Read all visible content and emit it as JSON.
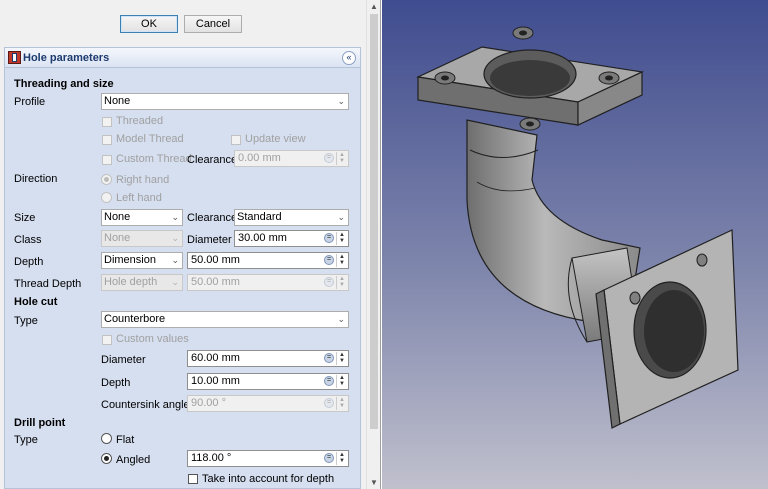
{
  "buttons": {
    "ok": "OK",
    "cancel": "Cancel"
  },
  "box": {
    "title": "Hole parameters",
    "collapse_glyph": "«"
  },
  "threading": {
    "section": "Threading and size",
    "profile_label": "Profile",
    "profile_value": "None",
    "threaded": "Threaded",
    "model_thread": "Model Thread",
    "update_view": "Update view",
    "custom_thread": "Custom Thread",
    "clearance_label": "Clearance",
    "clearance_value": "0.00 mm",
    "direction_label": "Direction",
    "right_hand": "Right hand",
    "left_hand": "Left hand",
    "size_label": "Size",
    "size_value": "None",
    "size_clearance_label": "Clearance",
    "size_clearance_value": "Standard",
    "class_label": "Class",
    "class_value": "None",
    "diameter_label": "Diameter",
    "diameter_value": "30.00 mm",
    "depth_label": "Depth",
    "depth_type": "Dimension",
    "depth_value": "50.00 mm",
    "thread_depth_label": "Thread Depth",
    "thread_depth_type": "Hole depth",
    "thread_depth_value": "50.00 mm"
  },
  "holecut": {
    "section": "Hole cut",
    "type_label": "Type",
    "type_value": "Counterbore",
    "custom_values": "Custom values",
    "diameter_label": "Diameter",
    "diameter_value": "60.00 mm",
    "depth_label": "Depth",
    "depth_value": "10.00 mm",
    "countersink_label": "Countersink angle",
    "countersink_value": "90.00 °"
  },
  "drill": {
    "section": "Drill point",
    "type_label": "Type",
    "flat": "Flat",
    "angled": "Angled",
    "angled_value": "118.00 °",
    "take_into_account": "Take into account for depth"
  },
  "colors": {
    "panel_bg": "#f0f0f0",
    "section_bg": "#d6dff0",
    "view_top": "#3f4c8f",
    "view_bottom": "#c0c0cd"
  }
}
